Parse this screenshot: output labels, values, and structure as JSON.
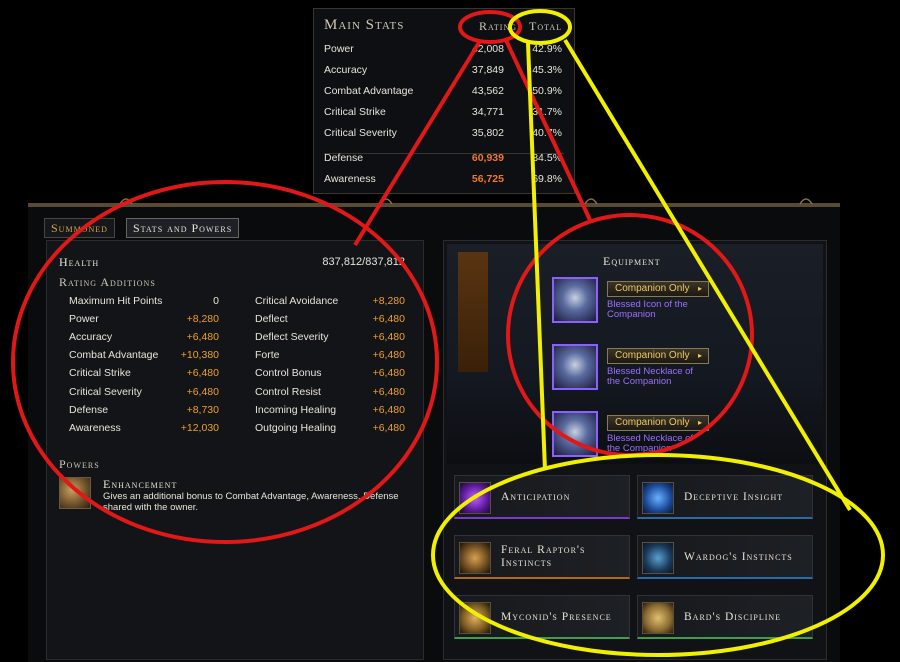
{
  "main_stats": {
    "title": "Main Stats",
    "col_rating": "Rating",
    "col_total": "Total",
    "rows": [
      {
        "label": "Power",
        "rating": "42,008",
        "total": "42.9%"
      },
      {
        "label": "Accuracy",
        "rating": "37,849",
        "total": "45.3%"
      },
      {
        "label": "Combat Advantage",
        "rating": "43,562",
        "total": "50.9%"
      },
      {
        "label": "Critical Strike",
        "rating": "34,771",
        "total": "31.7%"
      },
      {
        "label": "Critical Severity",
        "rating": "35,802",
        "total": "40.7%"
      }
    ],
    "def_rows": [
      {
        "label": "Defense",
        "rating": "60,939",
        "total": "84.5%"
      },
      {
        "label": "Awareness",
        "rating": "56,725",
        "total": "69.8%"
      }
    ]
  },
  "tabs": {
    "summoned": "Summoned",
    "stats_and_powers": "Stats and Powers"
  },
  "left": {
    "health_label": "Health",
    "health_value": "837,812/837,812",
    "rating_additions_label": "Rating Additions",
    "col1": [
      {
        "label": "Maximum Hit Points",
        "value": "0"
      },
      {
        "label": "Power",
        "value": "+8,280"
      },
      {
        "label": "Accuracy",
        "value": "+6,480"
      },
      {
        "label": "Combat Advantage",
        "value": "+10,380"
      },
      {
        "label": "Critical Strike",
        "value": "+6,480"
      },
      {
        "label": "Critical Severity",
        "value": "+6,480"
      },
      {
        "label": "Defense",
        "value": "+8,730"
      },
      {
        "label": "Awareness",
        "value": "+12,030"
      }
    ],
    "col2": [
      {
        "label": "Critical Avoidance",
        "value": "+8,280"
      },
      {
        "label": "Deflect",
        "value": "+6,480"
      },
      {
        "label": "Deflect Severity",
        "value": "+6,480"
      },
      {
        "label": "Forte",
        "value": "+6,480"
      },
      {
        "label": "Control Bonus",
        "value": "+6,480"
      },
      {
        "label": "Control Resist",
        "value": "+6,480"
      },
      {
        "label": "Incoming Healing",
        "value": "+6,480"
      },
      {
        "label": "Outgoing Healing",
        "value": "+6,480"
      }
    ],
    "powers_label": "Powers",
    "power_name": "Enhancement",
    "power_desc": "Gives an additional bonus to Combat Advantage, Awareness, Defense shared with the owner."
  },
  "equipment": {
    "title": "Equipment",
    "items": [
      {
        "button": "Companion Only",
        "name": "Blessed Icon of the Companion"
      },
      {
        "button": "Companion Only",
        "name": "Blessed Necklace of the Companion"
      },
      {
        "button": "Companion Only",
        "name": "Blessed Necklace of the Companion"
      }
    ]
  },
  "boons": [
    {
      "name": "Anticipation"
    },
    {
      "name": "Deceptive Insight"
    },
    {
      "name": "Feral Raptor's Instincts"
    },
    {
      "name": "Wardog's Instincts"
    },
    {
      "name": "Myconid's Presence"
    },
    {
      "name": "Bard's Discipline"
    }
  ],
  "colors": {
    "rating_bonus": "#f0a030",
    "defense_rating": "#f07830",
    "epic_item": "#9a70ff",
    "annotation_red": "#e01818",
    "annotation_yellow": "#f0f000"
  }
}
